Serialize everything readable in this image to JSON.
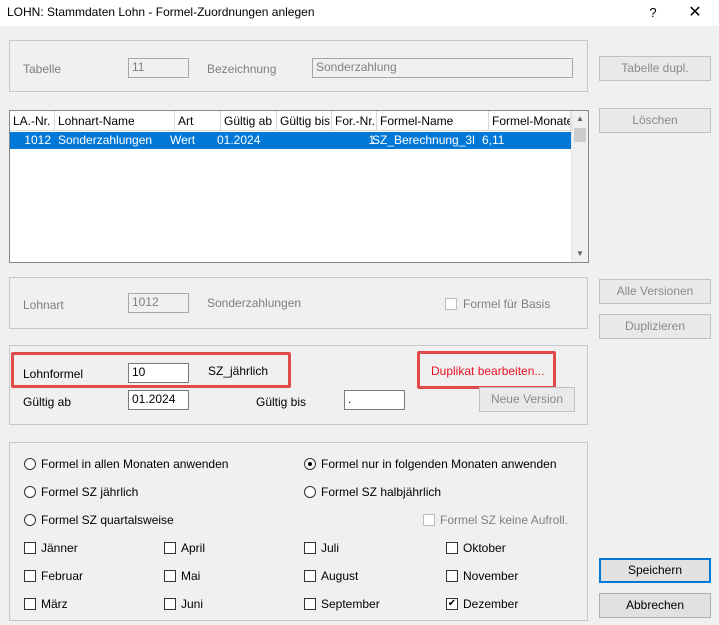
{
  "window": {
    "title": "LOHN: Stammdaten Lohn - Formel-Zuordnungen anlegen",
    "help": "?",
    "close": "✕"
  },
  "top_group": {
    "tabelle_label": "Tabelle",
    "tabelle_value": "11",
    "bezeichnung_label": "Bezeichnung",
    "bezeichnung_value": "Sonderzahlung"
  },
  "table": {
    "columns": [
      "LA.-Nr.",
      "Lohnart-Name",
      "Art",
      "Gültig ab",
      "Gültig bis",
      "For.-Nr.",
      "Formel-Name",
      "Formel-Monate"
    ],
    "rows": [
      [
        "1012",
        "Sonderzahlungen",
        "Wert",
        "01.2024",
        "",
        "1",
        "SZ_Berechnung_3l",
        "6,11"
      ]
    ],
    "scroll_up": "▲",
    "scroll_down": "▼"
  },
  "lohnart_group": {
    "label": "Lohnart",
    "value": "1012",
    "name": "Sonderzahlungen",
    "basis_label": "Formel für Basis"
  },
  "formel_group": {
    "lohnformel_label": "Lohnformel",
    "lohnformel_value": "10",
    "lohnformel_name": "SZ_jährlich",
    "duplikat_link": "Duplikat bearbeiten...",
    "gueltig_ab_label": "Gültig ab",
    "gueltig_ab_value": "01.2024",
    "gueltig_bis_label": "Gültig bis",
    "gueltig_bis_value": ".",
    "neue_version": "Neue Version"
  },
  "options": {
    "alle_monate": "Formel in allen Monaten anwenden",
    "folgende_monate": "Formel nur in folgenden Monaten anwenden",
    "sz_jaehrlich": "Formel SZ jährlich",
    "sz_halbjaehrlich": "Formel SZ halbjährlich",
    "sz_quartal": "Formel SZ quartalsweise",
    "keine_aufroll": "Formel SZ keine Aufroll.",
    "selected": "folgende_monate"
  },
  "months": {
    "jaenner": "Jänner",
    "april": "April",
    "juli": "Juli",
    "oktober": "Oktober",
    "februar": "Februar",
    "mai": "Mai",
    "august": "August",
    "november": "November",
    "maerz": "März",
    "juni": "Juni",
    "september": "September",
    "dezember": "Dezember",
    "checked_mark": "✔"
  },
  "buttons": {
    "tabelle_dupl": "Tabelle dupl.",
    "loeschen": "Löschen",
    "alle_versionen": "Alle Versionen",
    "duplizieren": "Duplizieren",
    "speichern": "Speichern",
    "abbrechen": "Abbrechen"
  },
  "colors": {
    "selection": "#0078d7",
    "highlight_red": "#e04a4a",
    "link_red": "#e81123"
  }
}
